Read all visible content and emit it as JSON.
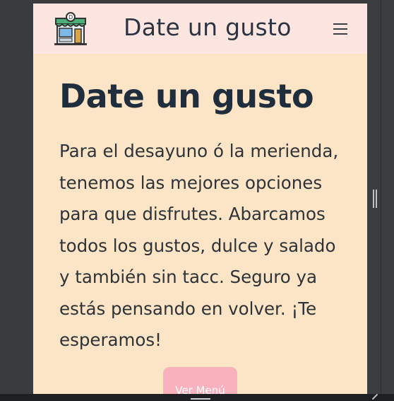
{
  "navbar": {
    "brand": "Date un gusto",
    "logo_icon": "storefront-icon",
    "menu_icon": "hamburger-menu-icon"
  },
  "hero": {
    "title": "Date un gusto",
    "text": "Para el desayuno ó la merienda, tenemos las mejores opciones para que disfrutes. Abarcamos todos los gustos, dulce y salado y también sin tacc. Seguro ya estás pensando en volver. ¡Te esperamos!",
    "button_label": "Ver Menú"
  },
  "colors": {
    "navbar_bg": "#fde6e1",
    "page_bg": "#fce5c6",
    "title_color": "#1f2d3d",
    "button_bg": "#f8b1bd",
    "frame_bg": "#3a3b3f"
  }
}
